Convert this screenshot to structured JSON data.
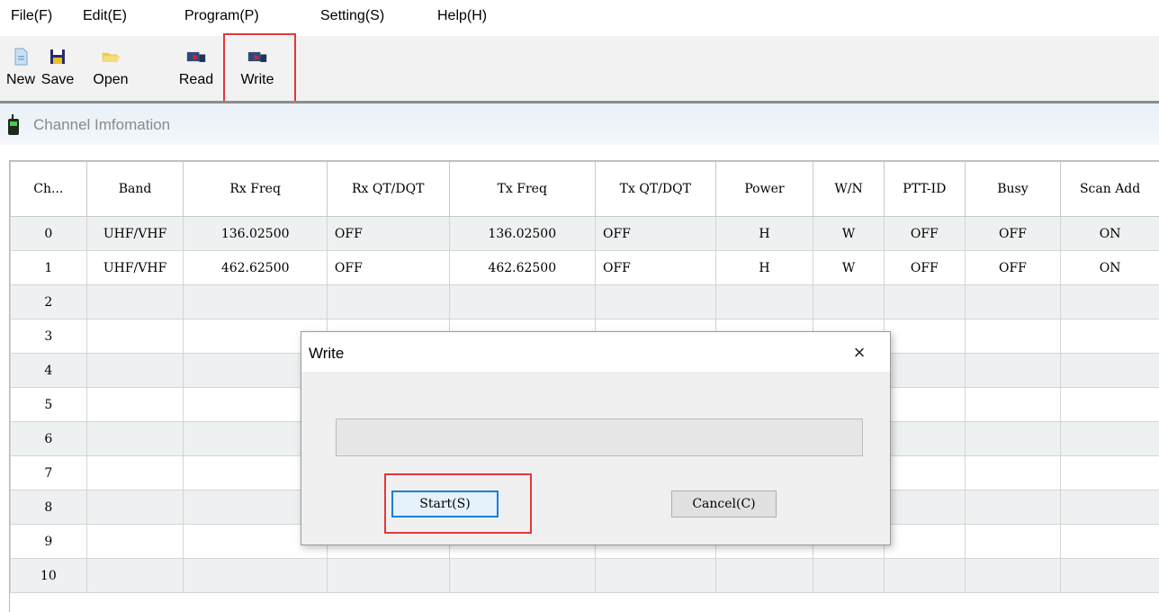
{
  "menu": [
    "File(F)",
    "Edit(E)",
    "Program(P)",
    "Setting(S)",
    "Help(H)"
  ],
  "toolbar": {
    "new_label": "New",
    "save_label": "Save",
    "open_label": "Open",
    "read_label": "Read",
    "write_label": "Write"
  },
  "section": {
    "title": "Channel Imfomation"
  },
  "grid": {
    "columns": [
      "Ch...",
      "Band",
      "Rx Freq",
      "Rx QT/DQT",
      "Tx Freq",
      "Tx QT/DQT",
      "Power",
      "W/N",
      "PTT-ID",
      "Busy",
      "Scan Add"
    ],
    "rows": [
      [
        "0",
        "UHF/VHF",
        "136.02500",
        "OFF",
        "136.02500",
        "OFF",
        "H",
        "W",
        "OFF",
        "OFF",
        "ON"
      ],
      [
        "1",
        "UHF/VHF",
        "462.62500",
        "OFF",
        "462.62500",
        "OFF",
        "H",
        "W",
        "OFF",
        "OFF",
        "ON"
      ],
      [
        "2",
        "",
        "",
        "",
        "",
        "",
        "",
        "",
        "",
        "",
        ""
      ],
      [
        "3",
        "",
        "",
        "",
        "",
        "",
        "",
        "",
        "",
        "",
        ""
      ],
      [
        "4",
        "",
        "",
        "",
        "",
        "",
        "",
        "",
        "",
        "",
        ""
      ],
      [
        "5",
        "",
        "",
        "",
        "",
        "",
        "",
        "",
        "",
        "",
        ""
      ],
      [
        "6",
        "",
        "",
        "",
        "",
        "",
        "",
        "",
        "",
        "",
        ""
      ],
      [
        "7",
        "",
        "",
        "",
        "",
        "",
        "",
        "",
        "",
        "",
        ""
      ],
      [
        "8",
        "",
        "",
        "",
        "",
        "",
        "",
        "",
        "",
        "",
        ""
      ],
      [
        "9",
        "",
        "",
        "",
        "",
        "",
        "",
        "",
        "",
        "",
        ""
      ],
      [
        "10",
        "",
        "",
        "",
        "",
        "",
        "",
        "",
        "",
        "",
        ""
      ]
    ]
  },
  "dialog": {
    "title": "Write",
    "close_glyph": "×",
    "start_label": "Start(S)",
    "cancel_label": "Cancel(C)"
  },
  "colors": {
    "highlight": "#e0383a",
    "focus": "#1a7fd8"
  }
}
